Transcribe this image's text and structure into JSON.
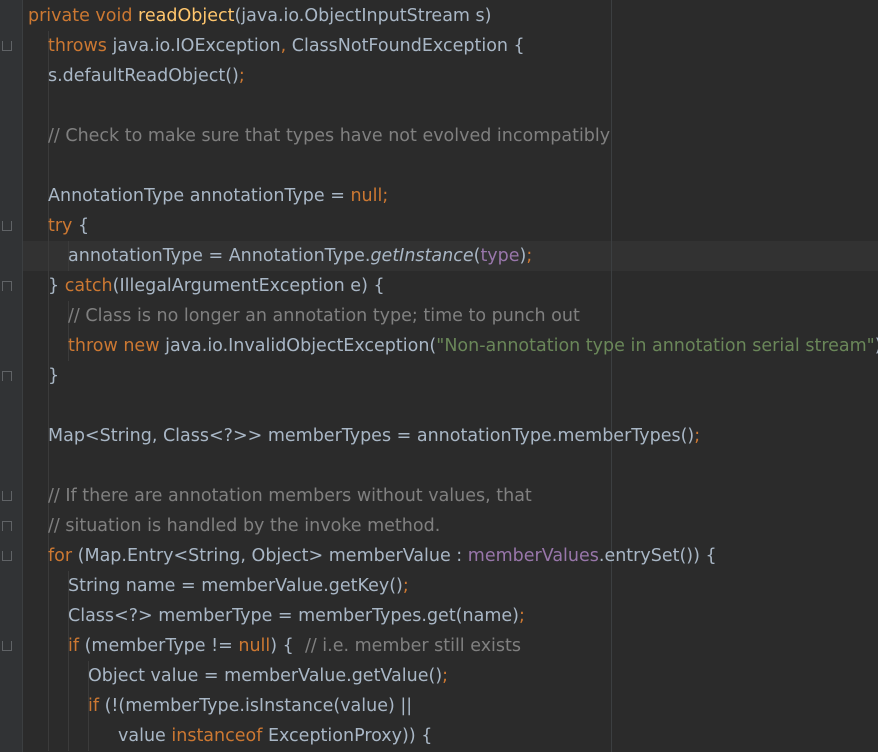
{
  "colors": {
    "background": "#2b2b2b",
    "gutter": "#313335",
    "keyword": "#cc7832",
    "method_declaration": "#ffc66d",
    "comment": "#808080",
    "string": "#6a8759",
    "field": "#9876aa",
    "plain": "#a9b7c6"
  },
  "code_lines": [
    [
      {
        "t": "private void ",
        "c": "kw"
      },
      {
        "t": "readObject",
        "c": "fn"
      },
      {
        "t": "(java.io.ObjectInputStream s)",
        "c": "pl"
      }
    ],
    [
      {
        "t": "throws ",
        "c": "kw"
      },
      {
        "t": "java.io.IOException",
        "c": "pl"
      },
      {
        "t": ", ",
        "c": "kw"
      },
      {
        "t": "ClassNotFoundException {",
        "c": "pl"
      }
    ],
    [
      {
        "t": "s.defaultReadObject()",
        "c": "pl"
      },
      {
        "t": ";",
        "c": "kw"
      }
    ],
    [],
    [
      {
        "t": "// Check to make sure that types have not evolved incompatibly",
        "c": "cm"
      }
    ],
    [],
    [
      {
        "t": "AnnotationType annotationType = ",
        "c": "pl"
      },
      {
        "t": "null;",
        "c": "kw"
      }
    ],
    [
      {
        "t": "try ",
        "c": "kw"
      },
      {
        "t": "{",
        "c": "pl"
      }
    ],
    [
      {
        "t": "annotationType = AnnotationType.",
        "c": "pl"
      },
      {
        "t": "getInstance",
        "c": "it"
      },
      {
        "t": "(",
        "c": "pl"
      },
      {
        "t": "type",
        "c": "fd"
      },
      {
        "t": ")",
        "c": "pl"
      },
      {
        "t": ";",
        "c": "kw"
      }
    ],
    [
      {
        "t": "} ",
        "c": "pl"
      },
      {
        "t": "catch",
        "c": "kw"
      },
      {
        "t": "(IllegalArgumentException e) {",
        "c": "pl"
      }
    ],
    [
      {
        "t": "// Class is no longer an annotation type; time to punch out",
        "c": "cm"
      }
    ],
    [
      {
        "t": "throw new ",
        "c": "kw"
      },
      {
        "t": "java.io.InvalidObjectException(",
        "c": "pl"
      },
      {
        "t": "\"Non-annotation type in annotation serial stream\"",
        "c": "st"
      },
      {
        "t": ")",
        "c": "pl"
      },
      {
        "t": ";",
        "c": "kw"
      }
    ],
    [
      {
        "t": "}",
        "c": "pl"
      }
    ],
    [],
    [
      {
        "t": "Map<String, Class<?>> memberTypes = annotationType.memberTypes()",
        "c": "pl"
      },
      {
        "t": ";",
        "c": "kw"
      }
    ],
    [],
    [
      {
        "t": "// If there are annotation members without values, that",
        "c": "cm"
      }
    ],
    [
      {
        "t": "// situation is handled by the invoke method.",
        "c": "cm"
      }
    ],
    [
      {
        "t": "for ",
        "c": "kw"
      },
      {
        "t": "(Map.Entry<String, Object> memberValue : ",
        "c": "pl"
      },
      {
        "t": "memberValues",
        "c": "fd"
      },
      {
        "t": ".entrySet()) {",
        "c": "pl"
      }
    ],
    [
      {
        "t": "String name = memberValue.getKey()",
        "c": "pl"
      },
      {
        "t": ";",
        "c": "kw"
      }
    ],
    [
      {
        "t": "Class<?> memberType = memberTypes.get(name)",
        "c": "pl"
      },
      {
        "t": ";",
        "c": "kw"
      }
    ],
    [
      {
        "t": "if ",
        "c": "kw"
      },
      {
        "t": "(memberType != ",
        "c": "pl"
      },
      {
        "t": "null",
        "c": "kw"
      },
      {
        "t": ") {  ",
        "c": "pl"
      },
      {
        "t": "// i.e. member still exists",
        "c": "cm"
      }
    ],
    [
      {
        "t": "Object value = memberValue.getValue()",
        "c": "pl"
      },
      {
        "t": ";",
        "c": "kw"
      }
    ],
    [
      {
        "t": "if ",
        "c": "kw"
      },
      {
        "t": "(!(memberType.isInstance(value) ||",
        "c": "pl"
      }
    ],
    [
      {
        "t": "value ",
        "c": "pl"
      },
      {
        "t": "instanceof ",
        "c": "kw"
      },
      {
        "t": "ExceptionProxy)) {",
        "c": "pl"
      }
    ]
  ]
}
